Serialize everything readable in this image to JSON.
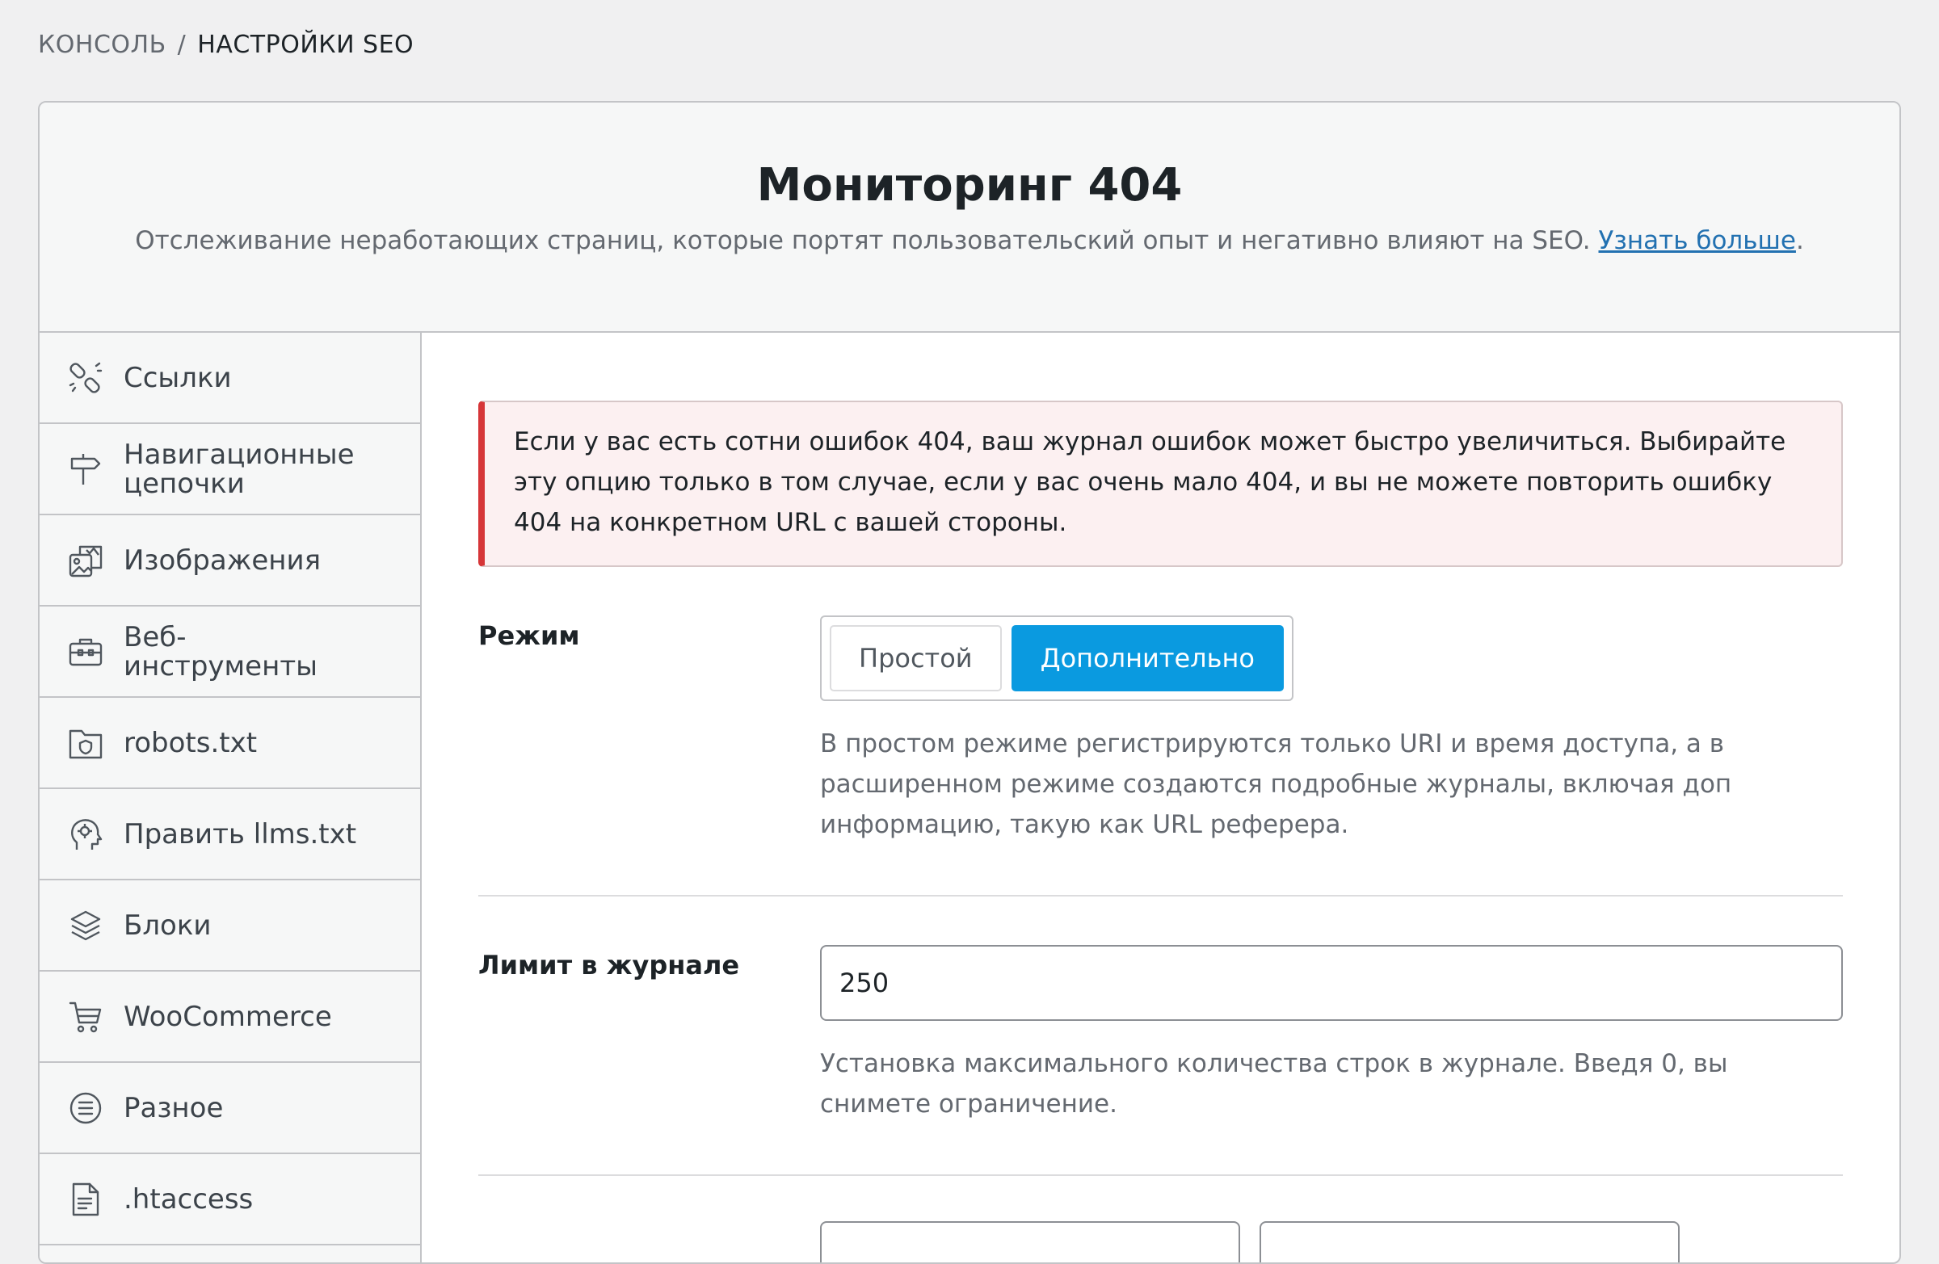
{
  "breadcrumb": {
    "parent": "КОНСОЛЬ",
    "separator": "/",
    "current": "НАСТРОЙКИ SEO"
  },
  "header": {
    "title": "Мониторинг 404",
    "description": "Отслеживание неработающих страниц, которые портят пользовательский опыт и негативно влияют на SEO.",
    "learn_more": "Узнать больше",
    "period": "."
  },
  "sidebar": {
    "items": [
      {
        "label": "Ссылки",
        "icon": "link-broken-icon"
      },
      {
        "label": "Навигационные цепочки",
        "icon": "signpost-icon"
      },
      {
        "label": "Изображения",
        "icon": "images-icon"
      },
      {
        "label": "Веб-инструменты",
        "icon": "toolbox-icon"
      },
      {
        "label": "robots.txt",
        "icon": "folder-shield-icon"
      },
      {
        "label": "Править llms.txt",
        "icon": "ai-head-icon"
      },
      {
        "label": "Блоки",
        "icon": "blocks-icon"
      },
      {
        "label": "WooCommerce",
        "icon": "cart-icon"
      },
      {
        "label": "Разное",
        "icon": "list-circle-icon"
      },
      {
        "label": ".htaccess",
        "icon": "file-icon"
      }
    ]
  },
  "notice": {
    "text": "Если у вас есть сотни ошибок 404, ваш журнал ошибок может быстро увеличиться. Выбирайте эту опцию только в том случае, если у вас очень мало 404, и вы не можете повторить ошибку 404 на конкретном URL с вашей стороны.",
    "accent_color": "#d63638"
  },
  "mode": {
    "label": "Режим",
    "options": [
      "Простой",
      "Дополнительно"
    ],
    "selected": "Дополнительно",
    "help": "В простом режиме регистрируются только URI и время доступа, а в расширенном режиме создаются подробные журналы, включая доп информацию, такую как URL реферера.",
    "active_color": "#0a9ae0"
  },
  "log_limit": {
    "label": "Лимит в журнале",
    "value": "250",
    "help": "Установка максимального количества строк в журнале. Введя 0, вы снимете ограничение."
  }
}
